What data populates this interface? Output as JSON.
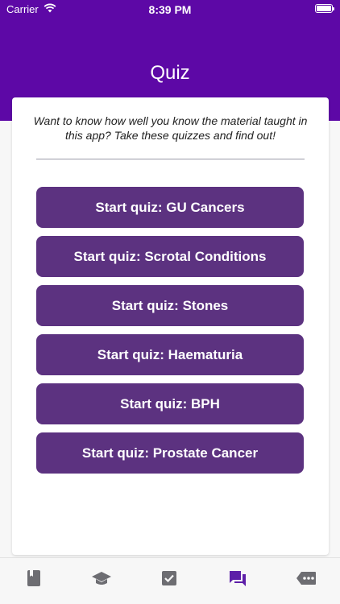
{
  "status_bar": {
    "carrier": "Carrier",
    "time": "8:39 PM"
  },
  "header": {
    "title": "Quiz"
  },
  "intro_text": "Want to know how well you know the material taught in this app? Take these quizzes and find out!",
  "quizzes": [
    {
      "label": "Start quiz: GU Cancers"
    },
    {
      "label": "Start quiz: Scrotal Conditions"
    },
    {
      "label": "Start quiz: Stones"
    },
    {
      "label": "Start quiz: Haematuria"
    },
    {
      "label": "Start quiz: BPH"
    },
    {
      "label": "Start quiz: Prostate Cancer"
    }
  ],
  "tabs": [
    {
      "icon": "book-icon",
      "active": false
    },
    {
      "icon": "graduation-cap-icon",
      "active": false
    },
    {
      "icon": "checkbox-icon",
      "active": false
    },
    {
      "icon": "chat-icon",
      "active": true
    },
    {
      "icon": "more-tag-icon",
      "active": false
    }
  ],
  "colors": {
    "header": "#5d08a6",
    "button": "#5c3280",
    "tab_active": "#5d1fa8",
    "tab_inactive": "#6d6d72"
  }
}
